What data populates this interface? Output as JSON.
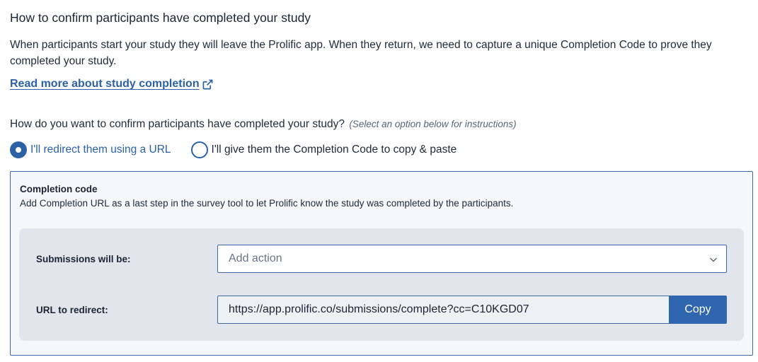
{
  "section": {
    "title": "How to confirm participants have completed your study",
    "description": "When participants start your study they will leave the Prolific app. When they return, we need to capture a unique Completion Code to prove they completed your study.",
    "link_label": "Read more about study completion"
  },
  "question": {
    "text": "How do you want to confirm participants have completed your study?",
    "hint": "(Select an option below for instructions)"
  },
  "options": [
    {
      "label": "I'll redirect them using a URL",
      "selected": true
    },
    {
      "label": "I'll give them the Completion Code to copy & paste",
      "selected": false
    }
  ],
  "panel": {
    "title": "Completion code",
    "description": "Add Completion URL as a last step in the survey tool to let Prolific know the study was completed by the participants.",
    "submissions_label": "Submissions will be:",
    "action_placeholder": "Add action",
    "url_label": "URL to redirect:",
    "url_value": "https://app.prolific.co/submissions/complete?cc=C10KGD07",
    "copy_label": "Copy"
  },
  "colors": {
    "accent": "#2c62a4",
    "panel_border": "#3a6aa8",
    "panel_bg": "#f5f7fa",
    "inner_bg": "#e2e6ec"
  },
  "icons": {
    "external_link": "external-link-icon",
    "dropdown": "chevron-down-icon"
  }
}
